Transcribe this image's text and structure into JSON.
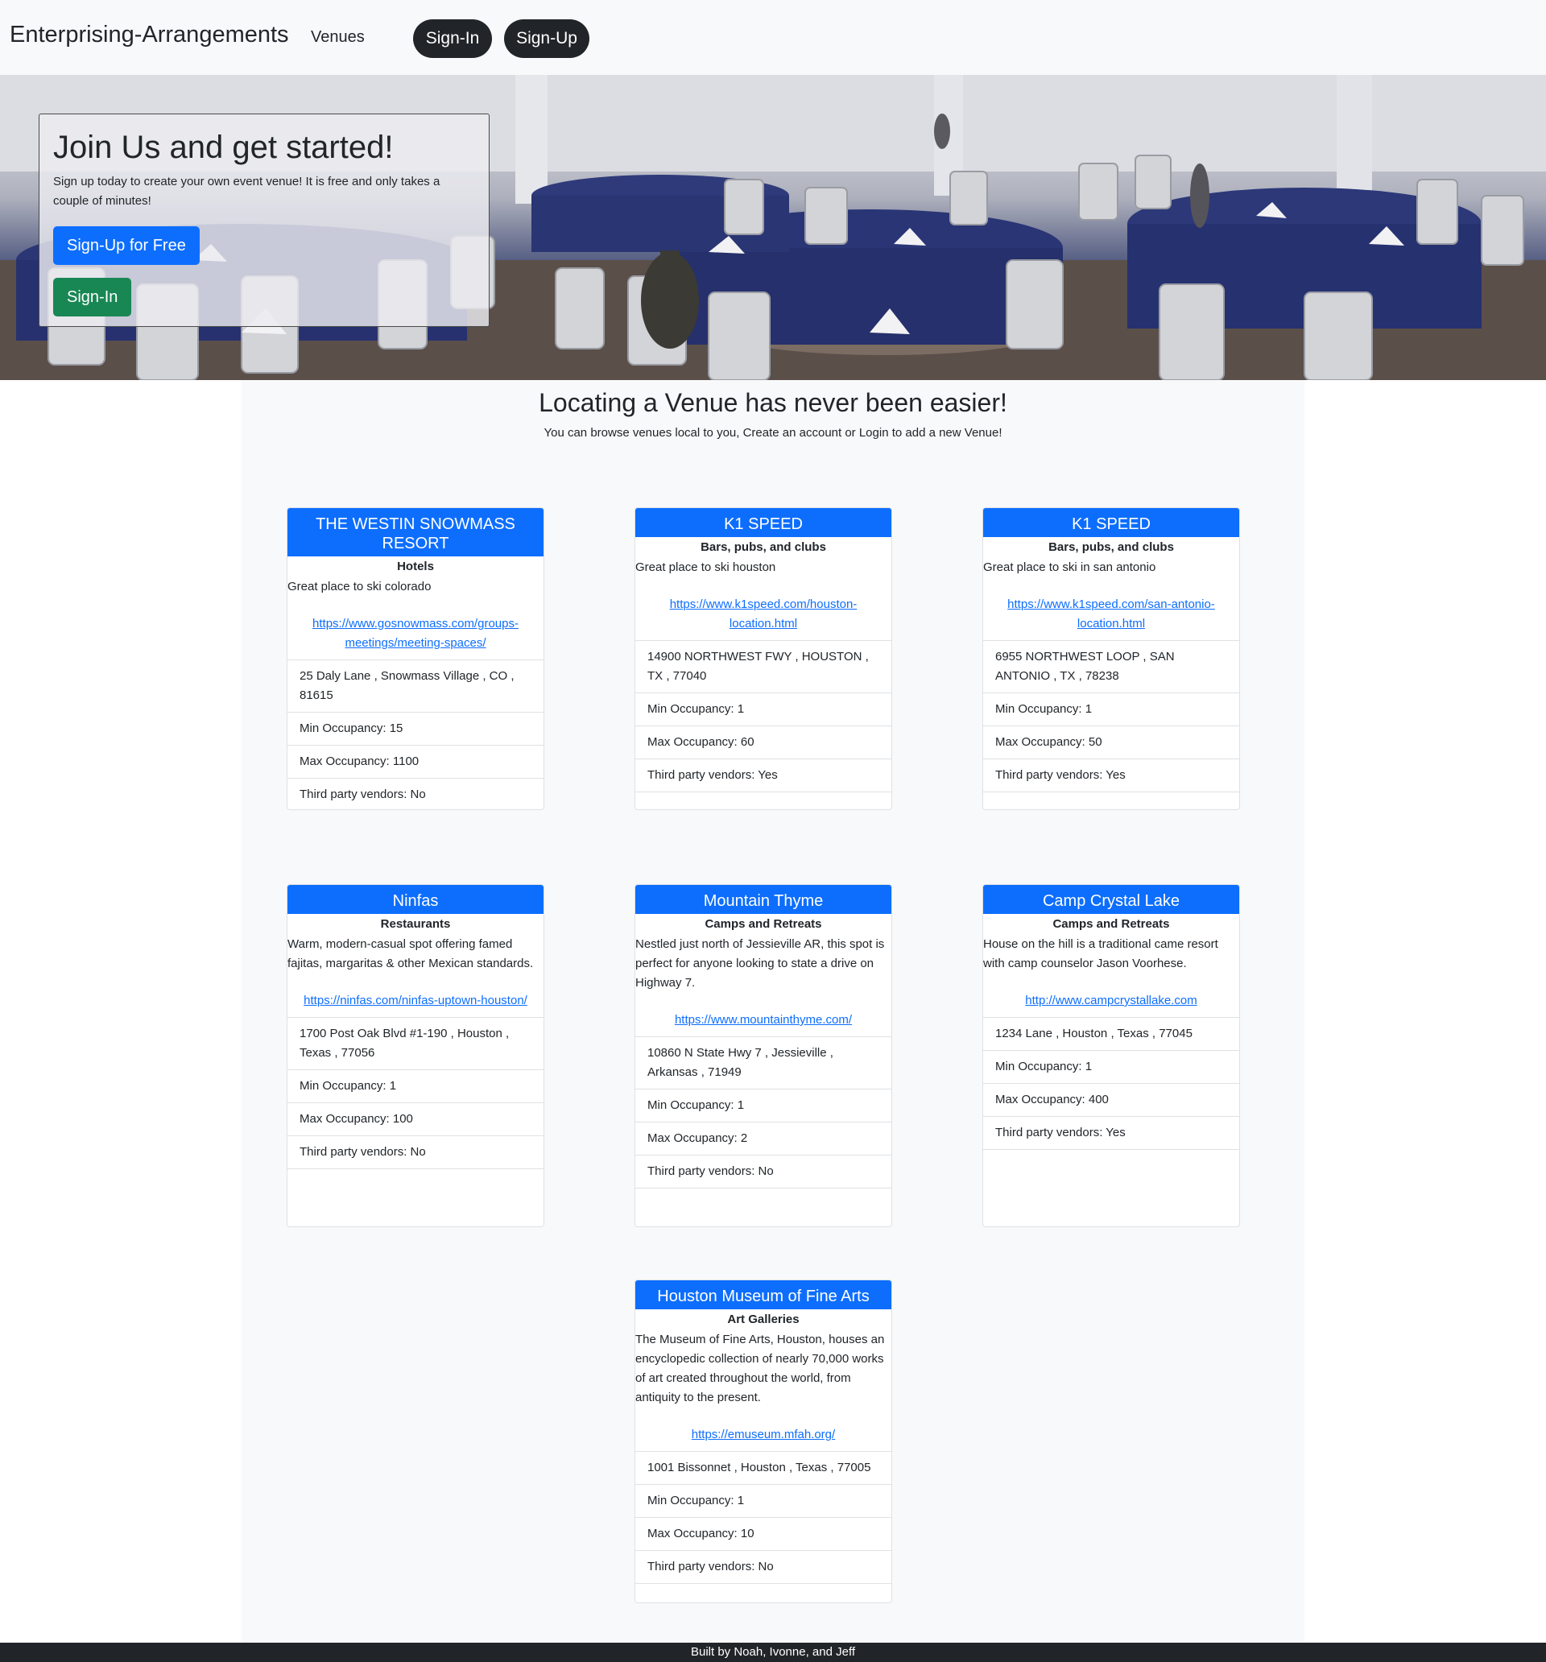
{
  "navbar": {
    "brand": "Enterprising-Arrangements",
    "venues_link": "Venues",
    "signin_label": "Sign-In",
    "signup_label": "Sign-Up"
  },
  "hero": {
    "title": "Join Us and get started!",
    "text": "Sign up today to create your own event venue! It is free and only takes a couple of minutes!",
    "signup_free_label": "Sign-Up for Free",
    "signin_label": "Sign-In"
  },
  "main": {
    "title": "Locating a Venue has never been easier!",
    "subtitle": "You can browse venues local to you, Create an account or Login to add a new Venue!"
  },
  "venues": [
    {
      "name": "THE WESTIN SNOWMASS RESORT",
      "category": "Hotels",
      "description": "Great place to ski colorado",
      "url": "https://www.gosnowmass.com/groups-meetings/meeting-spaces/",
      "address": "25 Daly Lane , Snowmass Village , CO , 81615",
      "min": "Min Occupancy: 15",
      "max": "Max Occupancy: 1100",
      "vendors": "Third party vendors: No"
    },
    {
      "name": "K1 SPEED",
      "category": "Bars, pubs, and clubs",
      "description": "Great place to ski houston",
      "url": "https://www.k1speed.com/houston-location.html",
      "address": "14900 NORTHWEST FWY , HOUSTON , TX , 77040",
      "min": "Min Occupancy: 1",
      "max": "Max Occupancy: 60",
      "vendors": "Third party vendors: Yes"
    },
    {
      "name": "K1 SPEED",
      "category": "Bars, pubs, and clubs",
      "description": "Great place to ski in san antonio",
      "url": "https://www.k1speed.com/san-antonio-location.html",
      "address": "6955 NORTHWEST LOOP , SAN ANTONIO , TX , 78238",
      "min": "Min Occupancy: 1",
      "max": "Max Occupancy: 50",
      "vendors": "Third party vendors: Yes"
    },
    {
      "name": "Ninfas",
      "category": "Restaurants",
      "description": "Warm, modern-casual spot offering famed fajitas, margaritas & other Mexican standards.",
      "url": "https://ninfas.com/ninfas-uptown-houston/",
      "address": "1700 Post Oak Blvd #1-190 , Houston , Texas , 77056",
      "min": "Min Occupancy: 1",
      "max": "Max Occupancy: 100",
      "vendors": "Third party vendors: No"
    },
    {
      "name": "Mountain Thyme",
      "category": "Camps and Retreats",
      "description": "Nestled just north of Jessieville AR, this spot is perfect for anyone looking to state a drive on Highway 7.",
      "url": "https://www.mountainthyme.com/",
      "address": "10860 N State Hwy 7 , Jessieville , Arkansas , 71949",
      "min": "Min Occupancy: 1",
      "max": "Max Occupancy: 2",
      "vendors": "Third party vendors: No"
    },
    {
      "name": "Camp Crystal Lake",
      "category": "Camps and Retreats",
      "description": "House on the hill is a traditional came resort with camp counselor Jason Voorhese.",
      "url": "http://www.campcrystallake.com",
      "address": "1234 Lane , Houston , Texas , 77045",
      "min": "Min Occupancy: 1",
      "max": "Max Occupancy: 400",
      "vendors": "Third party vendors: Yes"
    },
    {
      "name": "Houston Museum of Fine Arts",
      "category": "Art Galleries",
      "description": "The Museum of Fine Arts, Houston, houses an encyclopedic collection of nearly 70,000 works of art created throughout the world, from antiquity to the present.",
      "url": "https://emuseum.mfah.org/",
      "address": "1001 Bissonnet , Houston , Texas , 77005",
      "min": "Min Occupancy: 1",
      "max": "Max Occupancy: 10",
      "vendors": "Third party vendors: No"
    }
  ],
  "footer": {
    "text": "Built by Noah, Ivonne, and Jeff"
  }
}
